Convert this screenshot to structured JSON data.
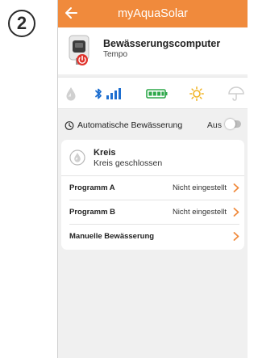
{
  "step_number": "2",
  "app": {
    "title": "myAquaSolar"
  },
  "device": {
    "name": "Bewässerungscomputer",
    "model": "Tempo"
  },
  "status_icons": [
    "water-drop-icon",
    "bluetooth-icon",
    "signal-strength-icon",
    "battery-icon",
    "sun-icon",
    "umbrella-icon"
  ],
  "automatic": {
    "label": "Automatische Bewässerung",
    "state_text": "Aus",
    "enabled": false
  },
  "circuit": {
    "name": "Kreis",
    "status": "Kreis geschlossen"
  },
  "programs": [
    {
      "label": "Programm A",
      "value": "Nicht eingestellt"
    },
    {
      "label": "Programm B",
      "value": "Nicht eingestellt"
    },
    {
      "label": "Manuelle Bewässerung",
      "value": ""
    }
  ],
  "colors": {
    "accent": "#f08a3c",
    "bluetooth": "#1e6fd0",
    "battery": "#2ea84a",
    "sun": "#f0b323"
  }
}
